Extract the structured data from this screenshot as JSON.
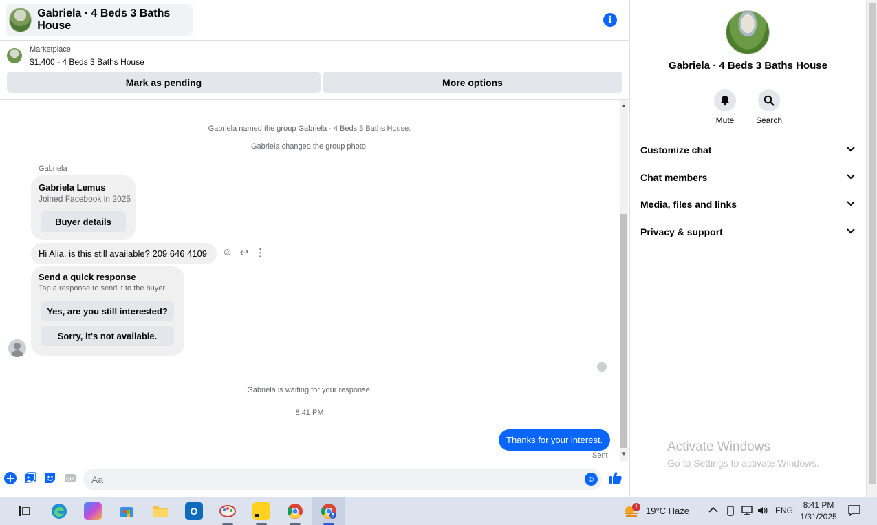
{
  "chat": {
    "title": "Gabriela · 4 Beds 3 Baths House",
    "listing": {
      "label": "Marketplace",
      "price_title": "$1,400 - 4 Beds 3 Baths House",
      "mark_pending": "Mark as pending",
      "more_options": "More options"
    },
    "messages": {
      "sys_named": "Gabriela named the group Gabriela · 4 Beds 3 Baths House.",
      "sys_photo": "Gabriela changed the group photo.",
      "sender": "Gabriela",
      "profile_name": "Gabriela Lemus",
      "profile_joined": "Joined Facebook in 2025",
      "buyer_details": "Buyer details",
      "inquiry": "Hi Alia, is this still available? 209 646 4109",
      "quick_title": "Send a quick response",
      "quick_sub": "Tap a response to send it to the buyer.",
      "quick_yes": "Yes, are you still interested?",
      "quick_no": "Sorry, it's not available.",
      "waiting": "Gabriela is waiting for your response.",
      "time": "8:41 PM",
      "reply": "Thanks for your interest.",
      "sent": "Sent"
    },
    "composer": {
      "placeholder": "Aa"
    }
  },
  "side": {
    "title": "Gabriela · 4 Beds 3 Baths House",
    "mute": "Mute",
    "search": "Search",
    "sections": [
      "Customize chat",
      "Chat members",
      "Media, files and links",
      "Privacy & support"
    ],
    "watermark_title": "Activate Windows",
    "watermark_sub": "Go to Settings to activate Windows."
  },
  "taskbar": {
    "weather": "19°C  Haze",
    "lang": "ENG",
    "time": "8:41 PM",
    "date": "1/31/2025",
    "weather_badge": "1"
  },
  "colors": {
    "accent": "#0866ff",
    "bubble_gray": "#f0f0f0",
    "button_gray": "#e4e6eb"
  }
}
